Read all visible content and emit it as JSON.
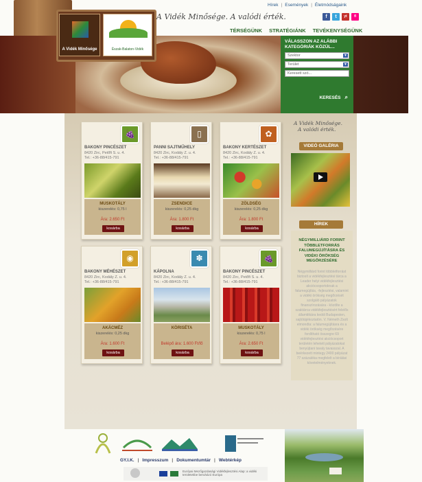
{
  "header": {
    "top_links": [
      "Hírek",
      "Események",
      "Életmódságaink"
    ],
    "slogan": "A Vidék Minősége. A valódi érték.",
    "logo1_text": "A Vidék Minősége",
    "logo2_text": "Észak-Balaton-Vidék",
    "nav": [
      "TÉRSÉGÜNK",
      "STRATÉGIÁNK",
      "TEVÉKENYSÉGÜNK"
    ],
    "social": [
      "f",
      "t",
      "yt",
      "fl"
    ]
  },
  "search": {
    "title": "VÁLASSZON AZ ALÁBBI KATEGÓRIÁK KÖZÜL...",
    "sector": "Szektor",
    "area": "Terület",
    "keyword_placeholder": "Keresett szó...",
    "button": "KERESÉS"
  },
  "products": [
    {
      "producer": "BAKONY PINCÉSZET",
      "addr1": "8420 Zirc, Petőfi S. u. 4.",
      "addr2": "Tel.: +36-88/415-791",
      "product": "MUSKOTÁLY",
      "qty": "kiszerelés: 0,75 l",
      "price": "Ára: 2.650 Ft",
      "cart": "kosárba",
      "icon": "wine-icon",
      "icon_color": "#6a9a2a",
      "photo": "grapes"
    },
    {
      "producer": "PANNI SAJTMŰHELY",
      "addr1": "8420 Zirc, Kodály Z. u. 4.",
      "addr2": "Tel.: +36-88/415-791",
      "product": "ZSENDICE",
      "qty": "kiszerelés: 0,25 dkg",
      "price": "Ára: 1.800 Ft",
      "cart": "kosárba",
      "icon": "milk-jug-icon",
      "icon_color": "#8a7050",
      "photo": "cheese"
    },
    {
      "producer": "BAKONY KERTÉSZET",
      "addr1": "8420 Zirc, Kodály Z. u. 4.",
      "addr2": "Tel.: +36-88/415-791",
      "product": "ZÖLDSÉG",
      "qty": "kiszerelés: 0,25 dkg",
      "price": "Ára: 1.800 Ft",
      "cart": "kosárba",
      "icon": "vegetable-icon",
      "icon_color": "#c06020",
      "photo": "vegetables"
    },
    {
      "producer": "BAKONY MÉHÉSZET",
      "addr1": "8420 Zirc, Kodály Z. u. 4.",
      "addr2": "Tel.: +36-88/415-791",
      "product": "AKÁCMÉZ",
      "qty": "kiszerelés: 0,25 dkg",
      "price": "Ára: 1.600 Ft",
      "cart": "kosárba",
      "icon": "beehive-icon",
      "icon_color": "#d2a02a",
      "photo": "honey"
    },
    {
      "producer": "KÁPOLNA",
      "addr1": "8420 Zirc, Kodály Z. u. 4.",
      "addr2": "Tel.: +36-88/415-791",
      "product": "KÖRISÉTA",
      "qty": "",
      "price": "Belépő ára: 1.600 Ft/fő",
      "cart": "kosárba",
      "icon": "flower-icon",
      "icon_color": "#3a8ab0",
      "photo": "chapel"
    },
    {
      "producer": "BAKONY PINCÉSZET",
      "addr1": "8420 Zirc, Petőfi S. u. 4.",
      "addr2": "Tel.: +36-88/415-791",
      "product": "MUSKOTÁLY",
      "qty": "kiszerelés: 0,75 l",
      "price": "Ára: 2.650 Ft",
      "cart": "kosárba",
      "icon": "wine-icon",
      "icon_color": "#6a9a2a",
      "photo": "cellar"
    }
  ],
  "sidebar": {
    "slogan_line1": "A Vidék Minősége.",
    "slogan_line2": "A valódi érték.",
    "video_label": "VIDEÓ GALÉRIA",
    "news_label": "HÍREK",
    "news_title": "NÉGYMILLIÁRD FORINT TÖBBLETFORRÁS FALUMEGÚJÍTÁSRA ÉS VIDÉKI ÖRÖKSÉG MEGŐRZÉSÉRE",
    "news_body": "Négymilliárd forint többletforrást biztosít a vidékfejlesztési tárca a Leader helyi vidékfejlesztési akciócsoportoknak a falumegújítás, -fejlesztési, valamint a vidéki örökség megőrzését szolgáló pályázatok finanszírozására - közölte a szaktárca vidékfejlesztésért felelős államtitkára keddi Budapesten, sajtótájékoztatón. V. Németh Zsolt elmondta: a falumegújításra és a vidéki örökség megőrzésére fordítható összegre 69 vidékfejlesztési akciócsoport területén lehetett pályázatokat benyújtani tavaly tavasszal. A beérkezett mintegy 2400 pályázat 77 százaléka megfelelt a bírálási követelményeknek."
  },
  "footer": {
    "links": [
      "GY.I.K.",
      "Impresszum",
      "Dokumentumtár",
      "Webtérkép"
    ],
    "eu_text": "Európai Mezőgazdasági Vidékfejlesztési Alap: a vidéki területekbe beruházó Európa"
  },
  "colors": {
    "nav_green": "#2e6a2e",
    "search_green": "#2f7a2f",
    "cart_red": "#6e1212",
    "price_red": "#c0392b",
    "pill_gold": "#a57a38"
  }
}
